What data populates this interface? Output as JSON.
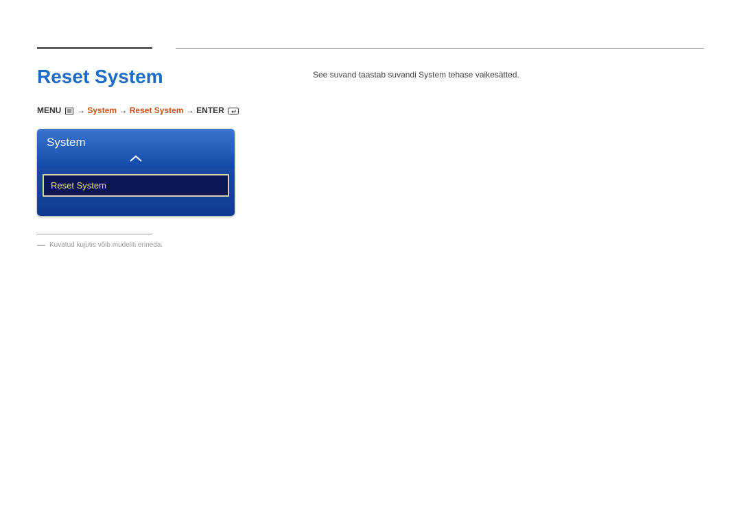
{
  "title": "Reset System",
  "breadcrumb": {
    "menu": "MENU",
    "system": "System",
    "reset_system": "Reset System",
    "enter": "ENTER",
    "sep": "→"
  },
  "panel": {
    "header": "System",
    "item": "Reset System"
  },
  "footnote": "Kuvatud kujutis võib mudeliti erineda.",
  "description": "See suvand taastab suvandi System tehase vaikesätted."
}
